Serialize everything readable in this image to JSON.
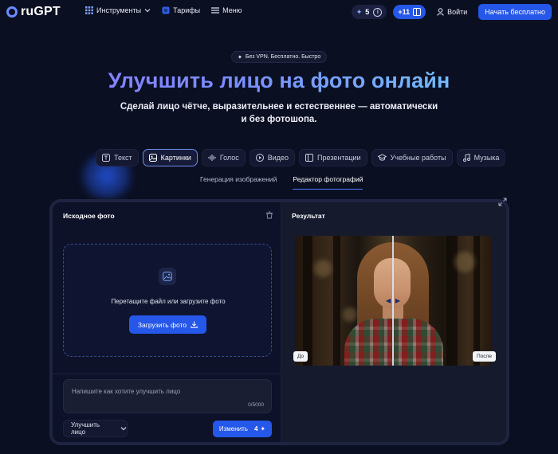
{
  "header": {
    "logo": "ruGPT",
    "nav": [
      {
        "label": "Инструменты",
        "icon": "grid-icon"
      },
      {
        "label": "Тарифы",
        "icon": "plan-icon"
      },
      {
        "label": "Меню",
        "icon": "hamburger-icon"
      }
    ],
    "credits": "5",
    "bonus": "+11",
    "login": "Войти",
    "cta": "Начать бесплатно"
  },
  "hero": {
    "badge": "Без VPN. Бесплатно. Быстро",
    "title": "Улучшить лицо на фото онлайн",
    "subtitle": "Сделай лицо чётче, выразительнее и естественнее — автоматически и без фотошопа."
  },
  "categories": [
    {
      "label": "Текст",
      "icon": "text-icon",
      "active": false
    },
    {
      "label": "Картинки",
      "icon": "image-icon",
      "active": true
    },
    {
      "label": "Голос",
      "icon": "voice-icon",
      "active": false
    },
    {
      "label": "Видео",
      "icon": "video-icon",
      "active": false
    },
    {
      "label": "Презентации",
      "icon": "presentation-icon",
      "active": false
    },
    {
      "label": "Учебные работы",
      "icon": "education-icon",
      "active": false
    },
    {
      "label": "Музыка",
      "icon": "music-icon",
      "active": false
    }
  ],
  "subtabs": [
    {
      "label": "Генерация изображений",
      "active": false
    },
    {
      "label": "Редактор фотографий",
      "active": true
    }
  ],
  "editor": {
    "source_title": "Исходное фото",
    "dropzone_text": "Перетащите файл или загрузите фото",
    "upload_label": "Загрузить фото",
    "prompt_placeholder": "Напишите как хотите улучшить лицо",
    "prompt_counter": "0/5000",
    "mode_label": "Улучшить лицо",
    "submit_label": "Изменить",
    "submit_cost": "4",
    "result_title": "Результат",
    "before_label": "До",
    "after_label": "После"
  },
  "colors": {
    "background": "#0b0f22",
    "accent": "#2557e8",
    "title_gradient_start": "#8b7cff",
    "title_gradient_end": "#6fd0ff"
  }
}
